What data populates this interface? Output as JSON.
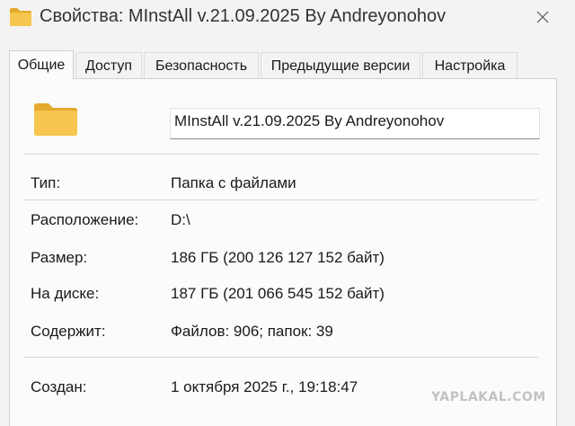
{
  "window": {
    "title": "Свойства: MInstAll v.21.09.2025 By Andreyonohov",
    "folder_icon": "folder-icon",
    "close_icon": "close-icon"
  },
  "tabs": [
    {
      "label": "Общие",
      "active": true
    },
    {
      "label": "Доступ",
      "active": false
    },
    {
      "label": "Безопасность",
      "active": false
    },
    {
      "label": "Предыдущие версии",
      "active": false
    },
    {
      "label": "Настройка",
      "active": false
    }
  ],
  "general": {
    "name_value": "MInstAll v.21.09.2025 By Andreyonohov",
    "type_label": "Тип:",
    "type_value": "Папка с файлами",
    "location_label": "Расположение:",
    "location_value": "D:\\",
    "size_label": "Размер:",
    "size_value": "186 ГБ (200 126 127 152 байт)",
    "disk_label": "На диске:",
    "disk_value": "187 ГБ (201 066 545 152 байт)",
    "contains_label": "Содержит:",
    "contains_value": "Файлов: 906; папок: 39",
    "created_label": "Создан:",
    "created_value": "1 октября 2025 г., 19:18:47"
  },
  "watermark": "YAPLAKAL.COM",
  "colors": {
    "folder": "#f6c64e",
    "folder_dark": "#e5a92b",
    "window_bg": "#f3f3f3",
    "panel_bg": "#fbfbfb"
  }
}
